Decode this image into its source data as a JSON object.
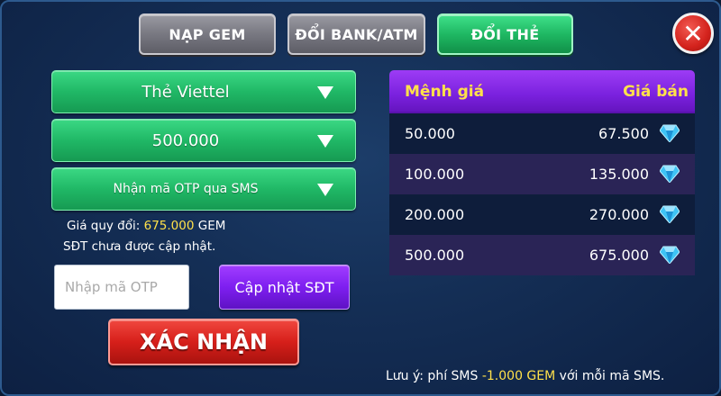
{
  "tabs": [
    {
      "label": "NẠP GEM",
      "active": false
    },
    {
      "label": "ĐỔI BANK/ATM",
      "active": false
    },
    {
      "label": "ĐỔI THẺ",
      "active": true
    }
  ],
  "close_icon": "close-x-icon",
  "form": {
    "card_type": "Thẻ Viettel",
    "card_value": "500.000",
    "otp_method": "Nhận mã OTP qua SMS",
    "rate_prefix": "Giá quy đổi: ",
    "rate_value": "675.000",
    "rate_suffix": " GEM",
    "phone_status": "SĐT chưa được cập nhật.",
    "otp_placeholder": "Nhập mã OTP",
    "update_phone_label": "Cập nhật SĐT",
    "confirm_label": "XÁC NHẬN"
  },
  "price_table": {
    "headers": {
      "face_value": "Mệnh giá",
      "sale_price": "Giá bán"
    },
    "rows": [
      {
        "face_value": "50.000",
        "sale_price": "67.500",
        "icon": "gem-icon"
      },
      {
        "face_value": "100.000",
        "sale_price": "135.000",
        "icon": "gem-icon"
      },
      {
        "face_value": "200.000",
        "sale_price": "270.000",
        "icon": "gem-icon"
      },
      {
        "face_value": "500.000",
        "sale_price": "675.000",
        "icon": "gem-icon"
      }
    ]
  },
  "note": {
    "prefix": "Lưu ý: phí SMS ",
    "highlight": "-1.000 GEM",
    "suffix": " với mỗi mã SMS."
  },
  "colors": {
    "accent_yellow": "#ffe14a",
    "green_button": "#20b866",
    "purple_button": "#7e1ff0",
    "red_button": "#d61f1a"
  }
}
